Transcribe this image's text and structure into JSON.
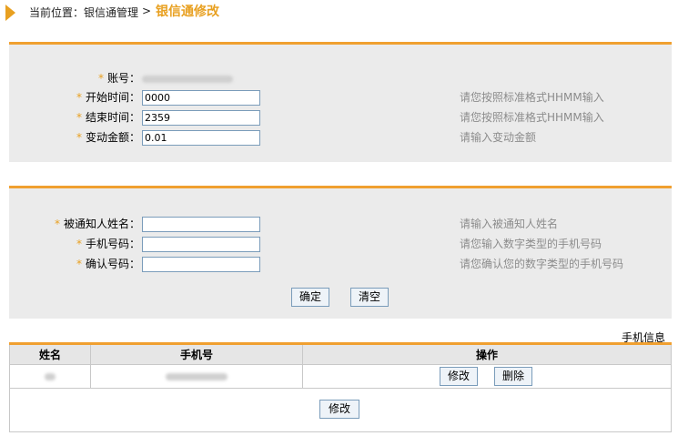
{
  "breadcrumb": {
    "prefix": "当前位置：银信通管理",
    "separator": ">",
    "current": "银信通修改"
  },
  "form1": {
    "account": {
      "label": "账号："
    },
    "start_time": {
      "label": "开始时间：",
      "value": "0000",
      "hint": "请您按照标准格式HHMM输入"
    },
    "end_time": {
      "label": "结束时间：",
      "value": "2359",
      "hint": "请您按照标准格式HHMM输入"
    },
    "amount": {
      "label": "变动金额：",
      "value": "0.01",
      "hint": "请输入变动金额"
    }
  },
  "form2": {
    "notify_name": {
      "label": "被通知人姓名：",
      "value": "",
      "hint": "请输入被通知人姓名"
    },
    "phone": {
      "label": "手机号码：",
      "value": "",
      "hint": "请您输入数字类型的手机号码"
    },
    "confirm_phone": {
      "label": "确认号码：",
      "value": "",
      "hint": "请您确认您的数字类型的手机号码"
    },
    "confirm_button": "确定",
    "clear_button": "清空"
  },
  "phone_info": {
    "title": "手机信息",
    "columns": [
      "姓名",
      "手机号",
      "操作"
    ],
    "row_actions": {
      "edit": "修改",
      "delete": "删除"
    },
    "footer_button": "修改"
  },
  "colors": {
    "accent": "#f0a030",
    "title": "#e8a020",
    "panel_bg": "#ebebeb",
    "hint": "#8c8c8c"
  }
}
